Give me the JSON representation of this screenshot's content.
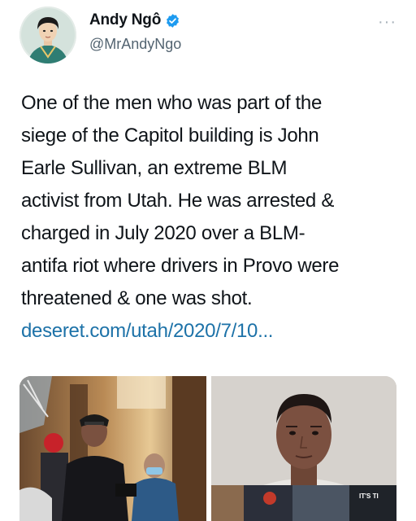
{
  "author": {
    "display_name": "Andy Ngô",
    "handle": "@MrAndyNgo",
    "verified": true
  },
  "icons": {
    "verified": "verified-badge-icon",
    "more": "more-options-icon"
  },
  "tweet": {
    "lines": [
      "One of the men who was part of the",
      "siege of the Capitol building is John",
      "Earle Sullivan, an extreme BLM",
      "activist from Utah. He was arrested &",
      "charged in July 2020 over a BLM-",
      "antifa riot where drivers in Provo were",
      "threatened & one was shot."
    ],
    "link": "deseret.com/utah/2020/7/10..."
  },
  "media": {
    "right_overlay_text": "IT'S TI"
  },
  "colors": {
    "link": "#1d72a8",
    "verified": "#1d9bf0",
    "secondary_text": "#536471"
  }
}
